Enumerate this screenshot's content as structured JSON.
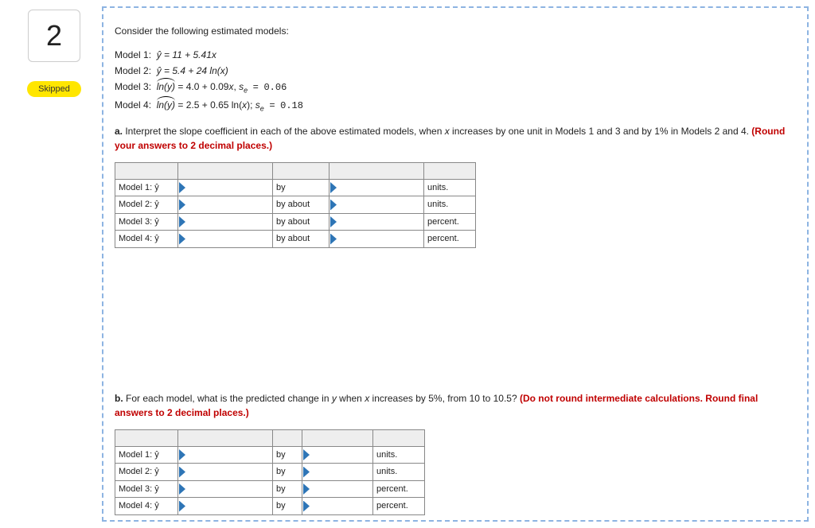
{
  "question_number": "2",
  "status_label": "Skipped",
  "intro": "Consider the following estimated models:",
  "models": {
    "m1_label": "Model 1:",
    "m1_eq": "ŷ = 11 + 5.41x",
    "m2_label": "Model 2:",
    "m2_eq": "ŷ = 5.4 + 24 ln(x)",
    "m3_label": "Model 3:",
    "m3_eq_main": "ln(y) = 4.0 + 0.09x,",
    "m3_se_label": "sₑ =",
    "m3_se_val": "0.06",
    "m4_label": "Model 4:",
    "m4_eq_main": "ln(y) = 2.5 + 0.65 ln(x);",
    "m4_se_label": "sₑ =",
    "m4_se_val": "0.18"
  },
  "part_a": {
    "label": "a.",
    "text": "Interpret the slope coefficient in each of the above estimated models, when x increases by one unit in Models 1 and 3 and by 1% in Models 2 and 4.",
    "rounding": "(Round your answers to 2 decimal places.)",
    "rows": [
      {
        "label": "Model 1: ŷ",
        "mid": "by",
        "unit": "units."
      },
      {
        "label": "Model 2: ŷ",
        "mid": "by about",
        "unit": "units."
      },
      {
        "label": "Model 3: ŷ",
        "mid": "by about",
        "unit": "percent."
      },
      {
        "label": "Model 4: ŷ",
        "mid": "by about",
        "unit": "percent."
      }
    ]
  },
  "part_b": {
    "label": "b.",
    "text": "For each model, what is the predicted change in y when x increases by 5%, from 10 to 10.5?",
    "rounding": "(Do not round intermediate calculations. Round final answers to 2 decimal places.)",
    "rows": [
      {
        "label": "Model 1: ŷ",
        "mid": "by",
        "unit": "units."
      },
      {
        "label": "Model 2: ŷ",
        "mid": "by",
        "unit": "units."
      },
      {
        "label": "Model 3: ŷ",
        "mid": "by",
        "unit": "percent."
      },
      {
        "label": "Model 4: ŷ",
        "mid": "by",
        "unit": "percent."
      }
    ]
  }
}
